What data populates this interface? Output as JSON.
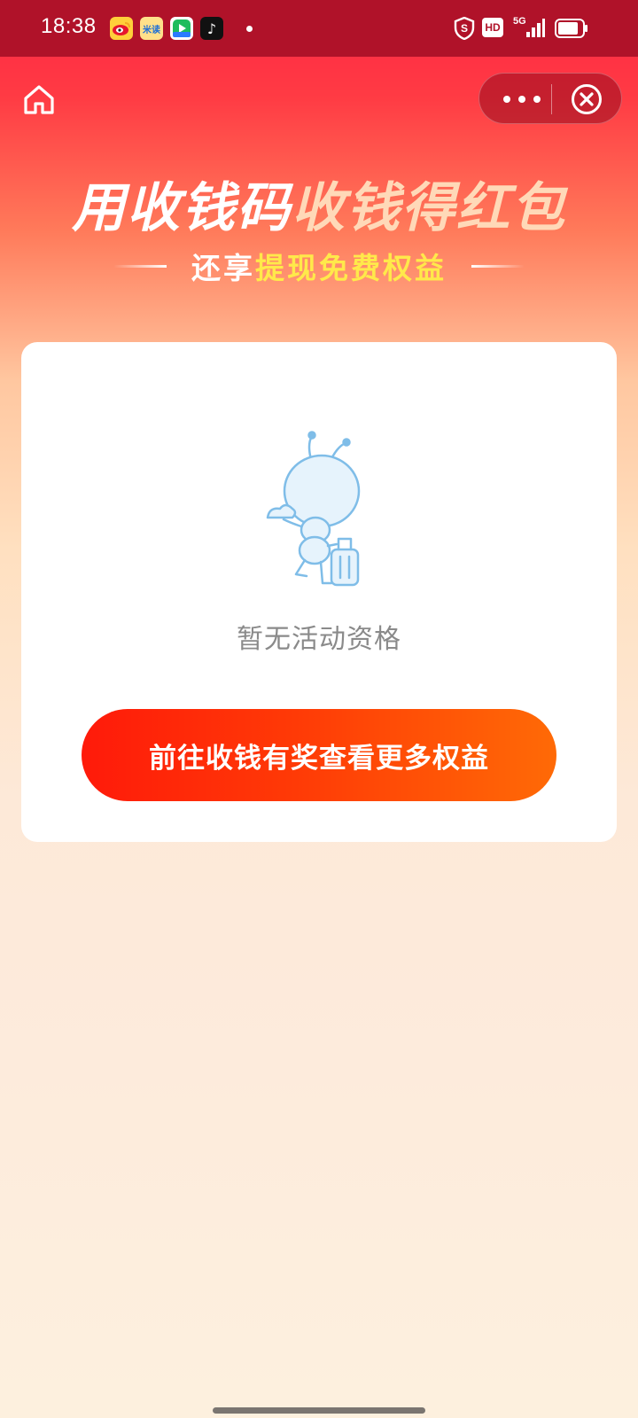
{
  "status_bar": {
    "time": "18:38",
    "apps": [
      {
        "name": "weibo-icon",
        "label": ""
      },
      {
        "name": "midu-icon",
        "label": "米读"
      },
      {
        "name": "video-icon",
        "label": ""
      },
      {
        "name": "tiktok-icon",
        "label": "♪"
      }
    ],
    "hd_label": "HD",
    "network_label": "5G"
  },
  "banner": {
    "title_white": "用收钱码",
    "title_gold": "收钱得红包",
    "subtitle_white": "还享",
    "subtitle_yellow": "提现免费权益"
  },
  "card": {
    "empty_text": "暂无活动资格",
    "cta_label": "前往收钱有奖查看更多权益"
  },
  "colors": {
    "status_bar": "#b01229",
    "cta_start": "#ff1a0a",
    "cta_end": "#ff6a06",
    "subtitle_highlight": "#ffe94a"
  }
}
